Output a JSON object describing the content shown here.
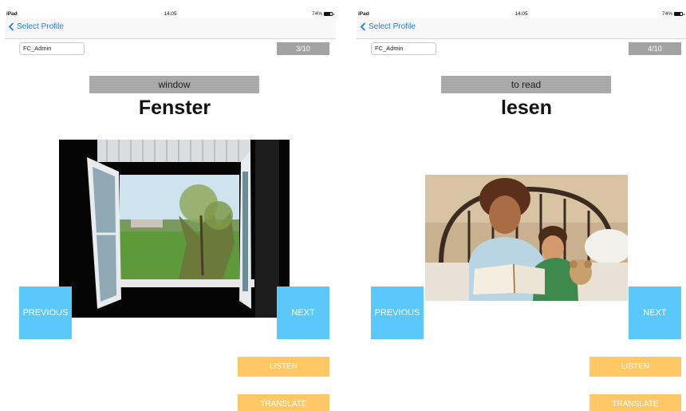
{
  "status_bar": {
    "carrier": "iPad",
    "time": "14:05",
    "battery": "74%",
    "battery_level": 0.74
  },
  "nav": {
    "back_label": "Select Profile"
  },
  "user": {
    "name": "FC_Admin"
  },
  "colors": {
    "accent_blue": "#1a7cf5",
    "nav_button": "#5ac8fa",
    "action_button": "#ffc864",
    "label_gray": "#a5a5a5"
  },
  "buttons": {
    "previous": "PREVIOUS",
    "next": "NEXT",
    "listen": "LISTEN",
    "translate": "TRANSLATE"
  },
  "cards": [
    {
      "progress": "3/10",
      "translation": "window",
      "word": "Fenster",
      "image": "open-window-photo"
    },
    {
      "progress": "4/10",
      "translation": "to read",
      "word": "lesen",
      "image": "mother-reading-to-child-photo"
    }
  ]
}
